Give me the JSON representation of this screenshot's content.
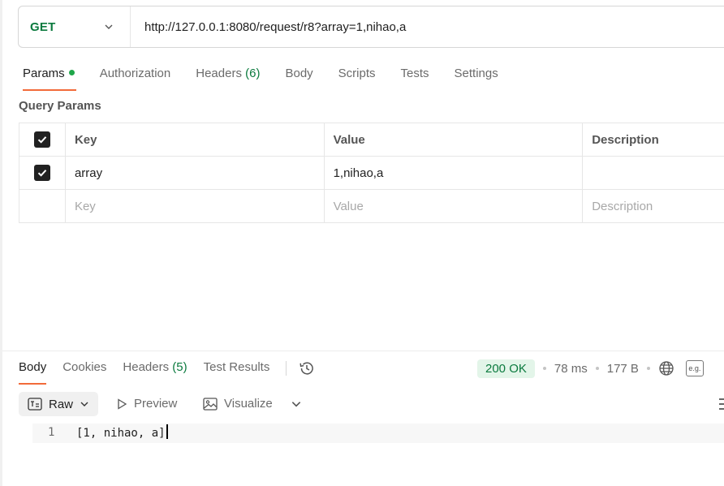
{
  "request": {
    "method": "GET",
    "url": "http://127.0.0.1:8080/request/r8?array=1,nihao,a"
  },
  "req_tabs": {
    "params": "Params",
    "authorization": "Authorization",
    "headers": "Headers",
    "headers_count": "(6)",
    "body": "Body",
    "scripts": "Scripts",
    "tests": "Tests",
    "settings": "Settings"
  },
  "query_params": {
    "title": "Query Params",
    "columns": {
      "key": "Key",
      "value": "Value",
      "description": "Description"
    },
    "rows": [
      {
        "checked": true,
        "key": "array",
        "value": "1,nihao,a",
        "description": ""
      }
    ],
    "placeholder": {
      "key": "Key",
      "value": "Value",
      "description": "Description"
    }
  },
  "response": {
    "tabs": {
      "body": "Body",
      "cookies": "Cookies",
      "headers": "Headers",
      "headers_count": "(5)",
      "test_results": "Test Results"
    },
    "status": "200 OK",
    "time": "78 ms",
    "size": "177 B",
    "eg_label": "e.g.",
    "format": "Raw",
    "preview": "Preview",
    "visualize": "Visualize",
    "lines": [
      {
        "number": "1",
        "text": "[1, nihao, a]"
      }
    ]
  },
  "colors": {
    "accent": "#f26b3a",
    "method_get": "#0b7a3e",
    "status_ok_bg": "#e3f5e9"
  }
}
